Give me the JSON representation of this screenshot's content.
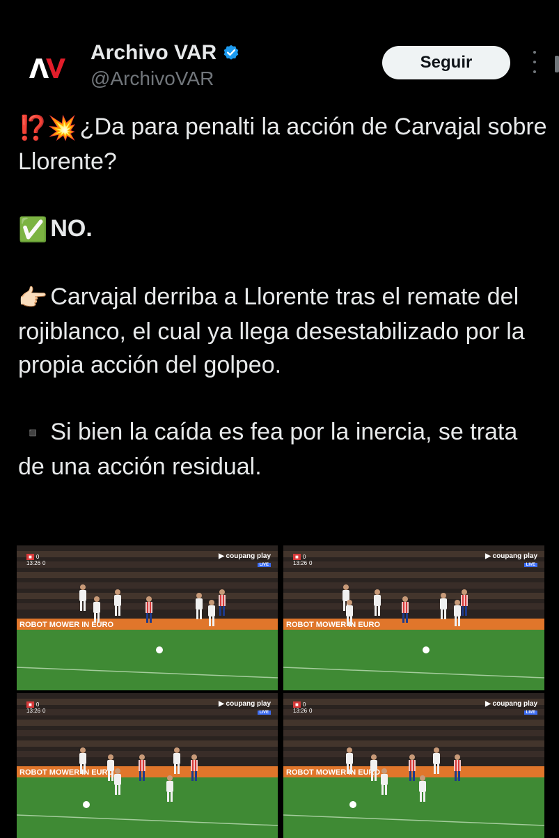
{
  "author": {
    "name": "Archivo VAR",
    "handle": "@ArchivoVAR",
    "follow_label": "Seguir"
  },
  "tweet": {
    "line1_emoji": "⁉️💥",
    "line1_text": "¿Da para penalti la acción de Carvajal sobre Llorente?",
    "line2_emoji": "✅",
    "line2_text": "NO.",
    "line3_emoji": "👉🏻",
    "line3_text": "Carvajal derriba a Llorente tras el remate del rojiblanco, el cual ya llega desestabilizado por la propia acción del golpeo.",
    "line4_emoji": "▪️",
    "line4_text": "Si bien la caída es fea por la inercia, se trata de una acción residual."
  },
  "media": {
    "frames": [
      {
        "score_home": "0",
        "score_away": "0",
        "clock": "13:26",
        "brand": "coupang play",
        "live": "LIVE"
      },
      {
        "score_home": "0",
        "score_away": "0",
        "clock": "13:26",
        "brand": "coupang play",
        "live": "LIVE"
      },
      {
        "score_home": "0",
        "score_away": "0",
        "clock": "13:26",
        "brand": "coupang play",
        "live": "LIVE"
      },
      {
        "score_home": "0",
        "score_away": "0",
        "clock": "13:26",
        "brand": "coupang play",
        "live": "LIVE"
      }
    ],
    "board_text": "ROBOT MOWER IN EURO"
  },
  "colors": {
    "background": "#000000",
    "text": "#e7e9ea",
    "secondary_text": "#71767b",
    "verified": "#1d9bf0",
    "follow_bg": "#eff3f4"
  }
}
